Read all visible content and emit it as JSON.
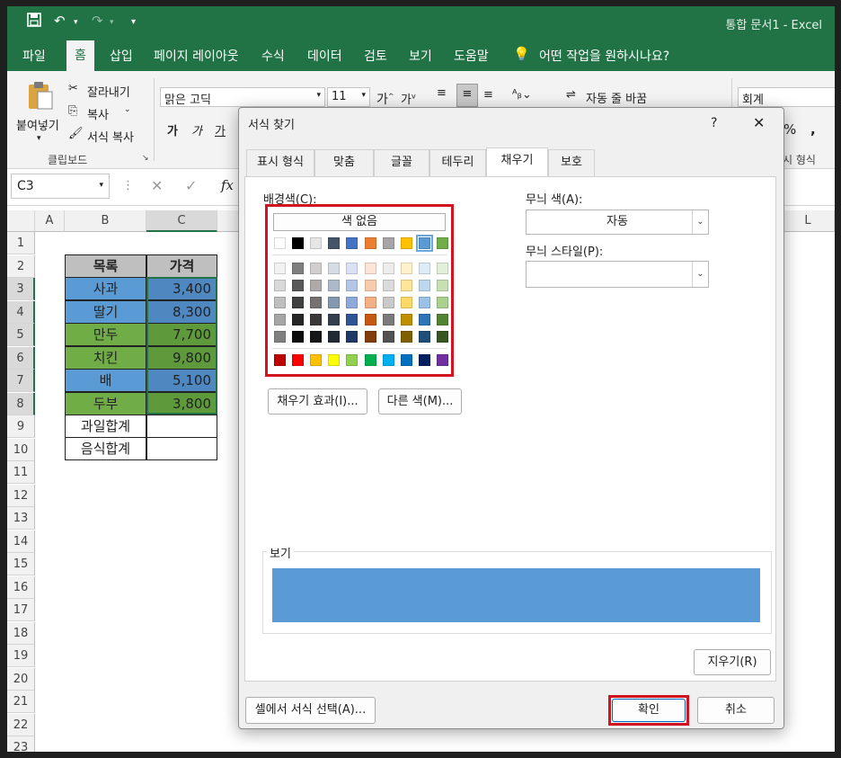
{
  "app": {
    "doc_title": "통합 문서1  -  Excel"
  },
  "menu": {
    "tabs": [
      "파일",
      "홈",
      "삽입",
      "페이지 레이아웃",
      "수식",
      "데이터",
      "검토",
      "보기",
      "도움말"
    ],
    "search_prompt": "어떤 작업을 원하시나요?"
  },
  "ribbon": {
    "paste": "붙여넣기",
    "cut": "잘라내기",
    "copy": "복사",
    "format_painter": "서식 복사",
    "clipboard_group": "클립보드",
    "font_name": "맑은 고딕",
    "font_size": "11",
    "bold": "가",
    "italic": "가",
    "underline": "가",
    "wrap_text": "자동 줄 바꿈",
    "number_format": "회계",
    "percent": "%",
    "comma": ",",
    "display_format_partial": "표시 형식"
  },
  "formula_bar": {
    "name_box": "C3",
    "fx": "fx"
  },
  "sheet": {
    "columns": [
      "A",
      "B",
      "C",
      "L"
    ],
    "rows": [
      "1",
      "2",
      "3",
      "4",
      "5",
      "6",
      "7",
      "8",
      "9",
      "10",
      "11",
      "12",
      "13",
      "14",
      "15",
      "16",
      "17",
      "18",
      "19",
      "20",
      "21",
      "22",
      "23"
    ],
    "header": {
      "item": "목록",
      "price": "가격"
    },
    "data": [
      {
        "item": "사과",
        "price": "3,400"
      },
      {
        "item": "딸기",
        "price": "8,300"
      },
      {
        "item": "만두",
        "price": "7,700"
      },
      {
        "item": "치킨",
        "price": "9,800"
      },
      {
        "item": "배",
        "price": "5,100"
      },
      {
        "item": "두부",
        "price": "3,800"
      }
    ],
    "fruit_total": "과일합계",
    "food_total": "음식합계",
    "colors": {
      "blue": "#5b9bd5",
      "blue_dark": "#4f87c0",
      "green": "#70ad47",
      "green_dark": "#5e9a3b"
    }
  },
  "dialog": {
    "title": "서식 찾기",
    "help": "?",
    "close": "✕",
    "tabs": [
      "표시 형식",
      "맞춤",
      "글꼴",
      "테두리",
      "채우기",
      "보호"
    ],
    "active_tab": "채우기",
    "bg_color_label": "배경색(C):",
    "no_color": "색 없음",
    "fill_effects": "채우기 효과(I)...",
    "more_colors": "다른 색(M)...",
    "pattern_color_label": "무늬 색(A):",
    "pattern_color_value": "자동",
    "pattern_style_label": "무늬 스타일(P):",
    "preview_label": "보기",
    "preview_color": "#5b9bd5",
    "clear": "지우기(R)",
    "choose_from_cell": "셀에서 서식 선택(A)...",
    "ok": "확인",
    "cancel": "취소",
    "theme_row": [
      "#ffffff",
      "#000000",
      "#e7e6e6",
      "#44546a",
      "#4472c4",
      "#ed7d31",
      "#a5a5a5",
      "#ffc000",
      "#5b9bd5",
      "#70ad47"
    ],
    "tint_rows": [
      [
        "#f2f2f2",
        "#7f7f7f",
        "#d0cece",
        "#d6dce4",
        "#d9e1f2",
        "#fce4d6",
        "#ededed",
        "#fff2cc",
        "#ddebf7",
        "#e2efda"
      ],
      [
        "#d9d9d9",
        "#595959",
        "#aeaaaa",
        "#acb9ca",
        "#b4c6e7",
        "#f8cbad",
        "#dbdbdb",
        "#ffe699",
        "#bdd7ee",
        "#c6e0b4"
      ],
      [
        "#bfbfbf",
        "#404040",
        "#757171",
        "#8497b0",
        "#8ea9db",
        "#f4b084",
        "#c9c9c9",
        "#ffd966",
        "#9bc2e6",
        "#a9d08e"
      ],
      [
        "#a6a6a6",
        "#262626",
        "#3a3838",
        "#333f4f",
        "#2f5597",
        "#c65911",
        "#7b7b7b",
        "#bf8f00",
        "#2e75b6",
        "#548235"
      ],
      [
        "#808080",
        "#0d0d0d",
        "#161616",
        "#222b35",
        "#1f3864",
        "#833c0c",
        "#525252",
        "#806000",
        "#1f4e78",
        "#375623"
      ]
    ],
    "standard_row": [
      "#c00000",
      "#ff0000",
      "#ffc000",
      "#ffff00",
      "#92d050",
      "#00b050",
      "#00b0f0",
      "#0070c0",
      "#002060",
      "#7030a0"
    ]
  }
}
